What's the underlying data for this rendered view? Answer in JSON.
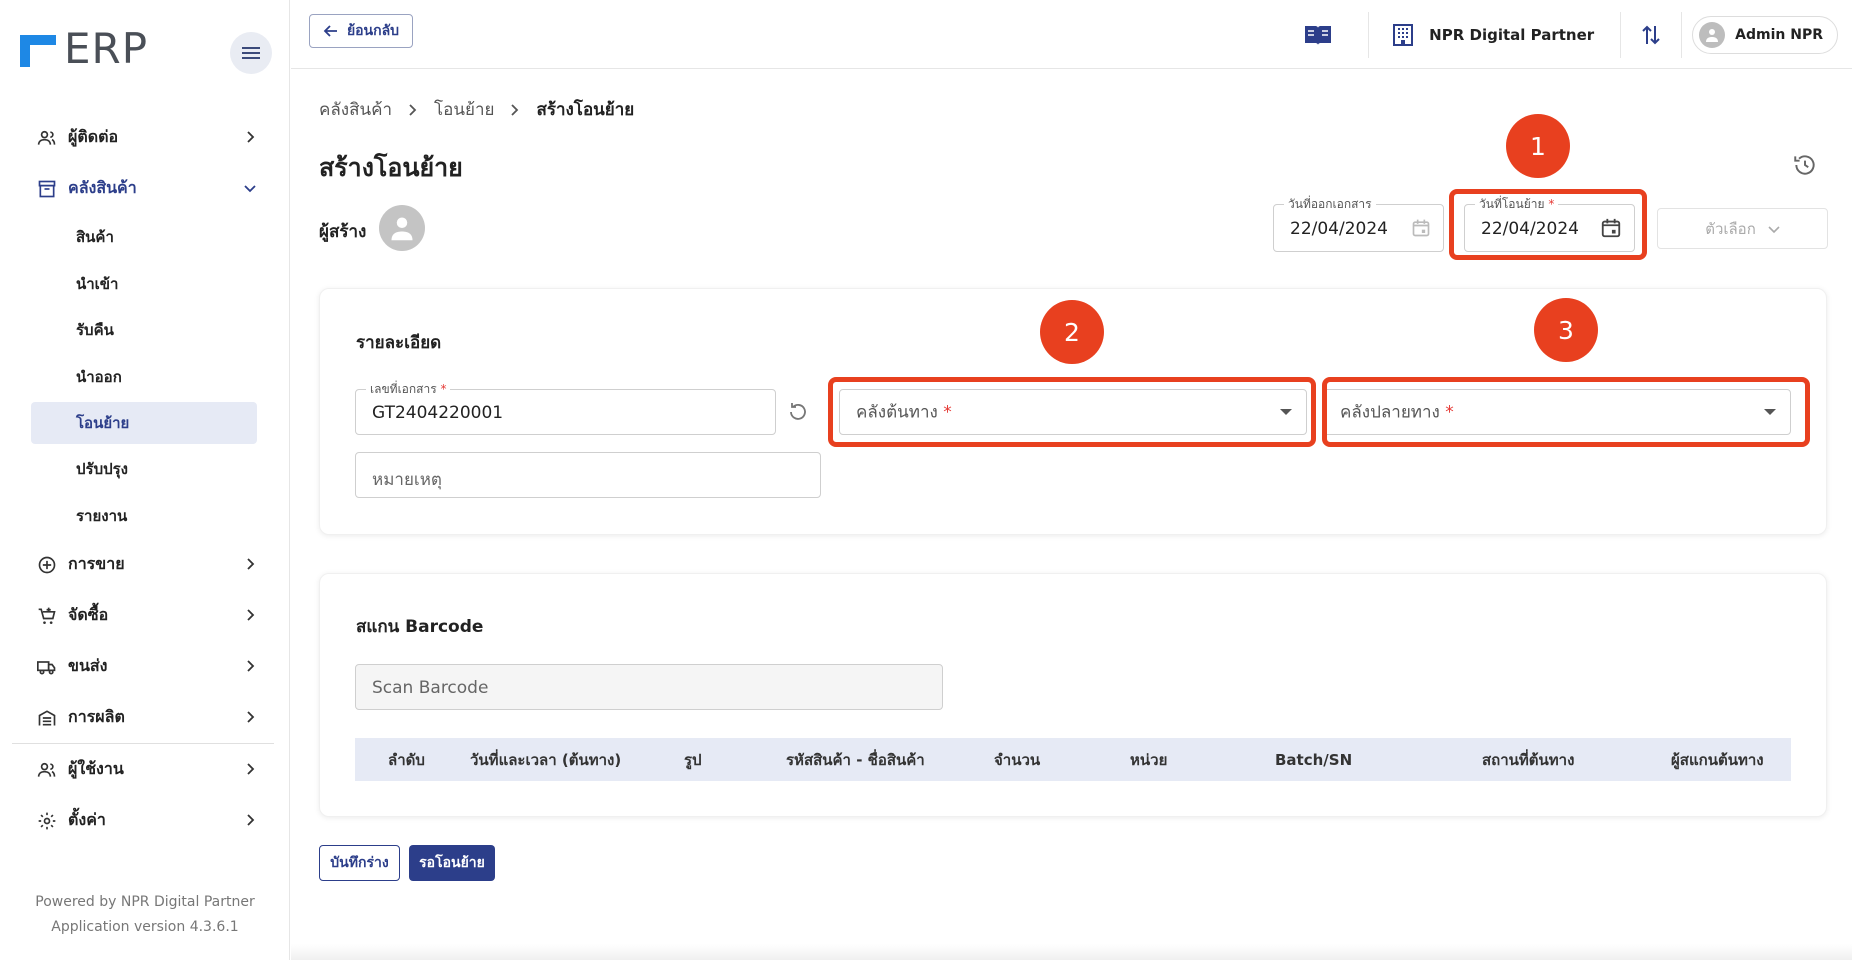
{
  "app": {
    "logo_text": "ERP"
  },
  "sidebar": {
    "items": [
      {
        "label": "ผู้ติดต่อ",
        "icon": "contacts-icon"
      },
      {
        "label": "คลังสินค้า",
        "icon": "warehouse-icon"
      },
      {
        "label": "การขาย",
        "icon": "plus-circle-icon"
      },
      {
        "label": "จัดซื้อ",
        "icon": "cart-icon"
      },
      {
        "label": "ขนส่ง",
        "icon": "truck-icon"
      },
      {
        "label": "การผลิต",
        "icon": "factory-icon"
      },
      {
        "label": "ผู้ใช้งาน",
        "icon": "users-icon"
      },
      {
        "label": "ตั้งค่า",
        "icon": "gear-icon"
      }
    ],
    "warehouse_sub": [
      "สินค้า",
      "นำเข้า",
      "รับคืน",
      "นำออก",
      "โอนย้าย",
      "ปรับปรุง",
      "รายงาน"
    ],
    "active_sub": "โอนย้าย",
    "footer_powered": "Powered by NPR Digital Partner",
    "footer_version": "Application version 4.3.6.1"
  },
  "topbar": {
    "back_label": "ย้อนกลับ",
    "company": "NPR Digital Partner",
    "user": "Admin NPR"
  },
  "breadcrumb": [
    "คลังสินค้า",
    "โอนย้าย",
    "สร้างโอนย้าย"
  ],
  "page": {
    "title": "สร้างโอนย้าย",
    "creator_label": "ผู้สร้าง",
    "issue_date_label": "วันที่ออกเอกสาร",
    "issue_date": "22/04/2024",
    "transfer_date_label": "วันที่โอนย้าย",
    "transfer_date": "22/04/2024",
    "options_label": "ตัวเลือก"
  },
  "details": {
    "title": "รายละเอียด",
    "doc_no_label": "เลขที่เอกสาร",
    "doc_no": "GT2404220001",
    "source_placeholder": "คลังต้นทาง",
    "dest_placeholder": "คลังปลายทาง",
    "remark_placeholder": "หมายเหตุ"
  },
  "scan": {
    "title": "สแกน Barcode",
    "placeholder": "Scan Barcode",
    "columns": [
      "ลำดับ",
      "วันที่และเวลา (ต้นทาง)",
      "รูป",
      "รหัสสินค้า - ชื่อสินค้า",
      "จำนวน",
      "หน่วย",
      "Batch/SN",
      "สถานที่ต้นทาง",
      "ผู้สแกนต้นทาง"
    ]
  },
  "actions": {
    "save_draft": "บันทึกร่าง",
    "pending": "รอโอนย้าย"
  },
  "annotations": [
    "1",
    "2",
    "3"
  ],
  "colors": {
    "primary": "#2c3e8a",
    "highlight": "#e8401f",
    "logo": "#1e88e5",
    "required": "#e53935"
  }
}
